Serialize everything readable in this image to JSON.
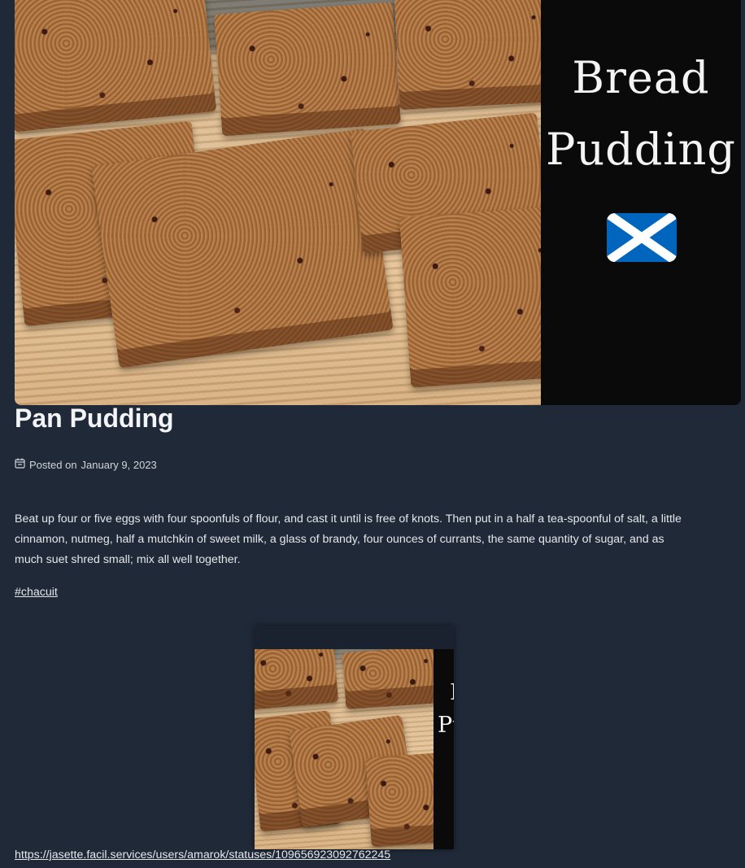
{
  "hero": {
    "panel_line1": "Bread",
    "panel_line2": "Pudding",
    "flag_icon": "scotland-flag-icon",
    "colors": {
      "panel_bg": "#0a0a0a",
      "flag_blue": "#0065bd"
    }
  },
  "post": {
    "title": "Pan Pudding",
    "posted_label": "Posted on",
    "date": "January 9, 2023",
    "date_icon": "calendar-icon",
    "body": "Beat up four or five eggs with four spoonfuls of flour, and cast it until is free of knots. Then put in a half a tea-spoonful of salt, a little cinnamon, nutmeg, half a mutchkin of sweet milk, a glass of brandy, four ounces of currants, the same quantity of sugar, and as much suet shred small; mix all well together.",
    "hashtag": "#chacuit"
  },
  "embed": {
    "panel_line1": "B",
    "panel_line2": "Pu"
  },
  "source_link": "https://jasette.facil.services/users/amarok/statuses/109656923092762245",
  "theme": {
    "background": "#1f2937",
    "text": "#e5e7eb"
  }
}
